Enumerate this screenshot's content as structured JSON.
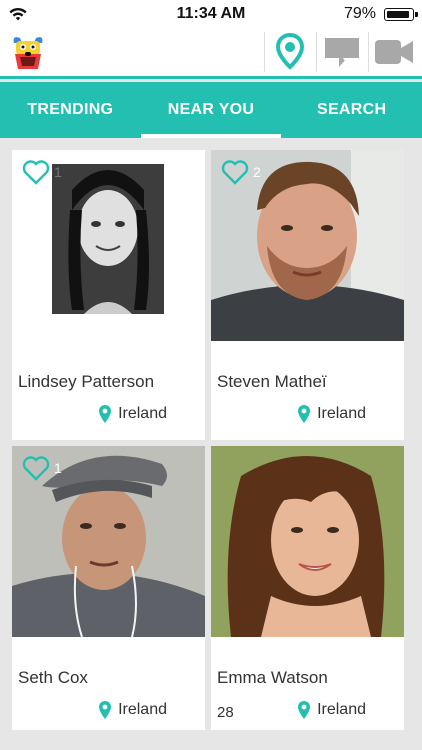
{
  "status_bar": {
    "time": "11:34 AM",
    "battery": "79%"
  },
  "tabs": [
    {
      "label": "TRENDING"
    },
    {
      "label": "NEAR YOU"
    },
    {
      "label": "SEARCH"
    }
  ],
  "active_tab": "NEAR YOU",
  "accent_color": "#23bfb0",
  "profiles": [
    {
      "name": "Lindsey Patterson",
      "location": "Ireland",
      "likes": "1",
      "age": ""
    },
    {
      "name": "Steven Matheï",
      "location": "Ireland",
      "likes": "2",
      "age": ""
    },
    {
      "name": "Seth Cox",
      "location": "Ireland",
      "likes": "1",
      "age": ""
    },
    {
      "name": "Emma Watson",
      "location": "Ireland",
      "likes": "",
      "age": "28"
    }
  ]
}
